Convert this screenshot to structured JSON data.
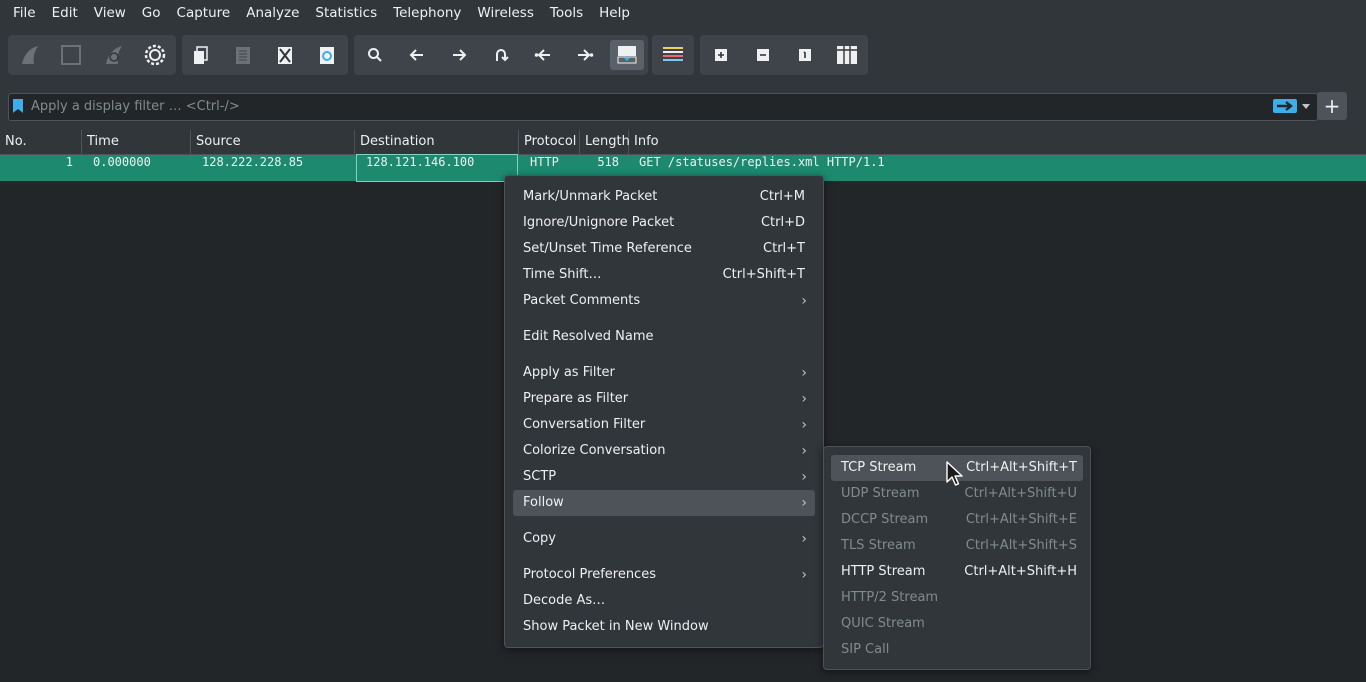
{
  "menubar": {
    "items": [
      "File",
      "Edit",
      "View",
      "Go",
      "Capture",
      "Analyze",
      "Statistics",
      "Telephony",
      "Wireless",
      "Tools",
      "Help"
    ]
  },
  "toolbar": {
    "icons": [
      "start-capture-icon",
      "stop-capture-icon",
      "restart-capture-icon",
      "capture-options-icon",
      "open-file-icon",
      "save-file-icon",
      "close-file-icon",
      "reload-file-icon",
      "find-packet-icon",
      "go-back-icon",
      "go-forward-icon",
      "go-to-packet-icon",
      "go-first-icon",
      "go-last-icon",
      "auto-scroll-icon",
      "colorize-icon",
      "zoom-in-icon",
      "zoom-out-icon",
      "normal-size-icon",
      "resize-columns-icon"
    ]
  },
  "filter": {
    "placeholder": "Apply a display filter … <Ctrl-/>",
    "add_label": "+"
  },
  "packet_list": {
    "columns": [
      "No.",
      "Time",
      "Source",
      "Destination",
      "Protocol",
      "Length",
      "Info"
    ],
    "rows": [
      {
        "no": "1",
        "time": "0.000000",
        "source": "128.222.228.85",
        "destination": "128.121.146.100",
        "protocol": "HTTP",
        "length": "518",
        "info": "GET /statuses/replies.xml HTTP/1.1"
      }
    ]
  },
  "context_menu": {
    "items": [
      {
        "label": "Mark/Unmark Packet",
        "shortcut": "Ctrl+M"
      },
      {
        "label": "Ignore/Unignore Packet",
        "shortcut": "Ctrl+D"
      },
      {
        "label": "Set/Unset Time Reference",
        "shortcut": "Ctrl+T"
      },
      {
        "label": "Time Shift…",
        "shortcut": "Ctrl+Shift+T"
      },
      {
        "label": "Packet Comments",
        "shortcut": ""
      },
      {
        "label": "Edit Resolved Name",
        "shortcut": ""
      },
      {
        "label": "Apply as Filter",
        "shortcut": ""
      },
      {
        "label": "Prepare as Filter",
        "shortcut": ""
      },
      {
        "label": "Conversation Filter",
        "shortcut": ""
      },
      {
        "label": "Colorize Conversation",
        "shortcut": ""
      },
      {
        "label": "SCTP",
        "shortcut": ""
      },
      {
        "label": "Follow",
        "shortcut": ""
      },
      {
        "label": "Copy",
        "shortcut": ""
      },
      {
        "label": "Protocol Preferences",
        "shortcut": ""
      },
      {
        "label": "Decode As…",
        "shortcut": ""
      },
      {
        "label": "Show Packet in New Window",
        "shortcut": ""
      }
    ]
  },
  "follow_submenu": {
    "items": [
      {
        "label": "TCP Stream",
        "shortcut": "Ctrl+Alt+Shift+T",
        "enabled": true
      },
      {
        "label": "UDP Stream",
        "shortcut": "Ctrl+Alt+Shift+U",
        "enabled": false
      },
      {
        "label": "DCCP Stream",
        "shortcut": "Ctrl+Alt+Shift+E",
        "enabled": false
      },
      {
        "label": "TLS Stream",
        "shortcut": "Ctrl+Alt+Shift+S",
        "enabled": false
      },
      {
        "label": "HTTP Stream",
        "shortcut": "Ctrl+Alt+Shift+H",
        "enabled": true
      },
      {
        "label": "HTTP/2 Stream",
        "shortcut": "",
        "enabled": false
      },
      {
        "label": "QUIC Stream",
        "shortcut": "",
        "enabled": false
      },
      {
        "label": "SIP Call",
        "shortcut": "",
        "enabled": false
      }
    ]
  },
  "colors": {
    "selected_row": "#1d8a70",
    "accent": "#3daee9",
    "background": "#31363b",
    "disabled_text": "#7f8c8d"
  }
}
